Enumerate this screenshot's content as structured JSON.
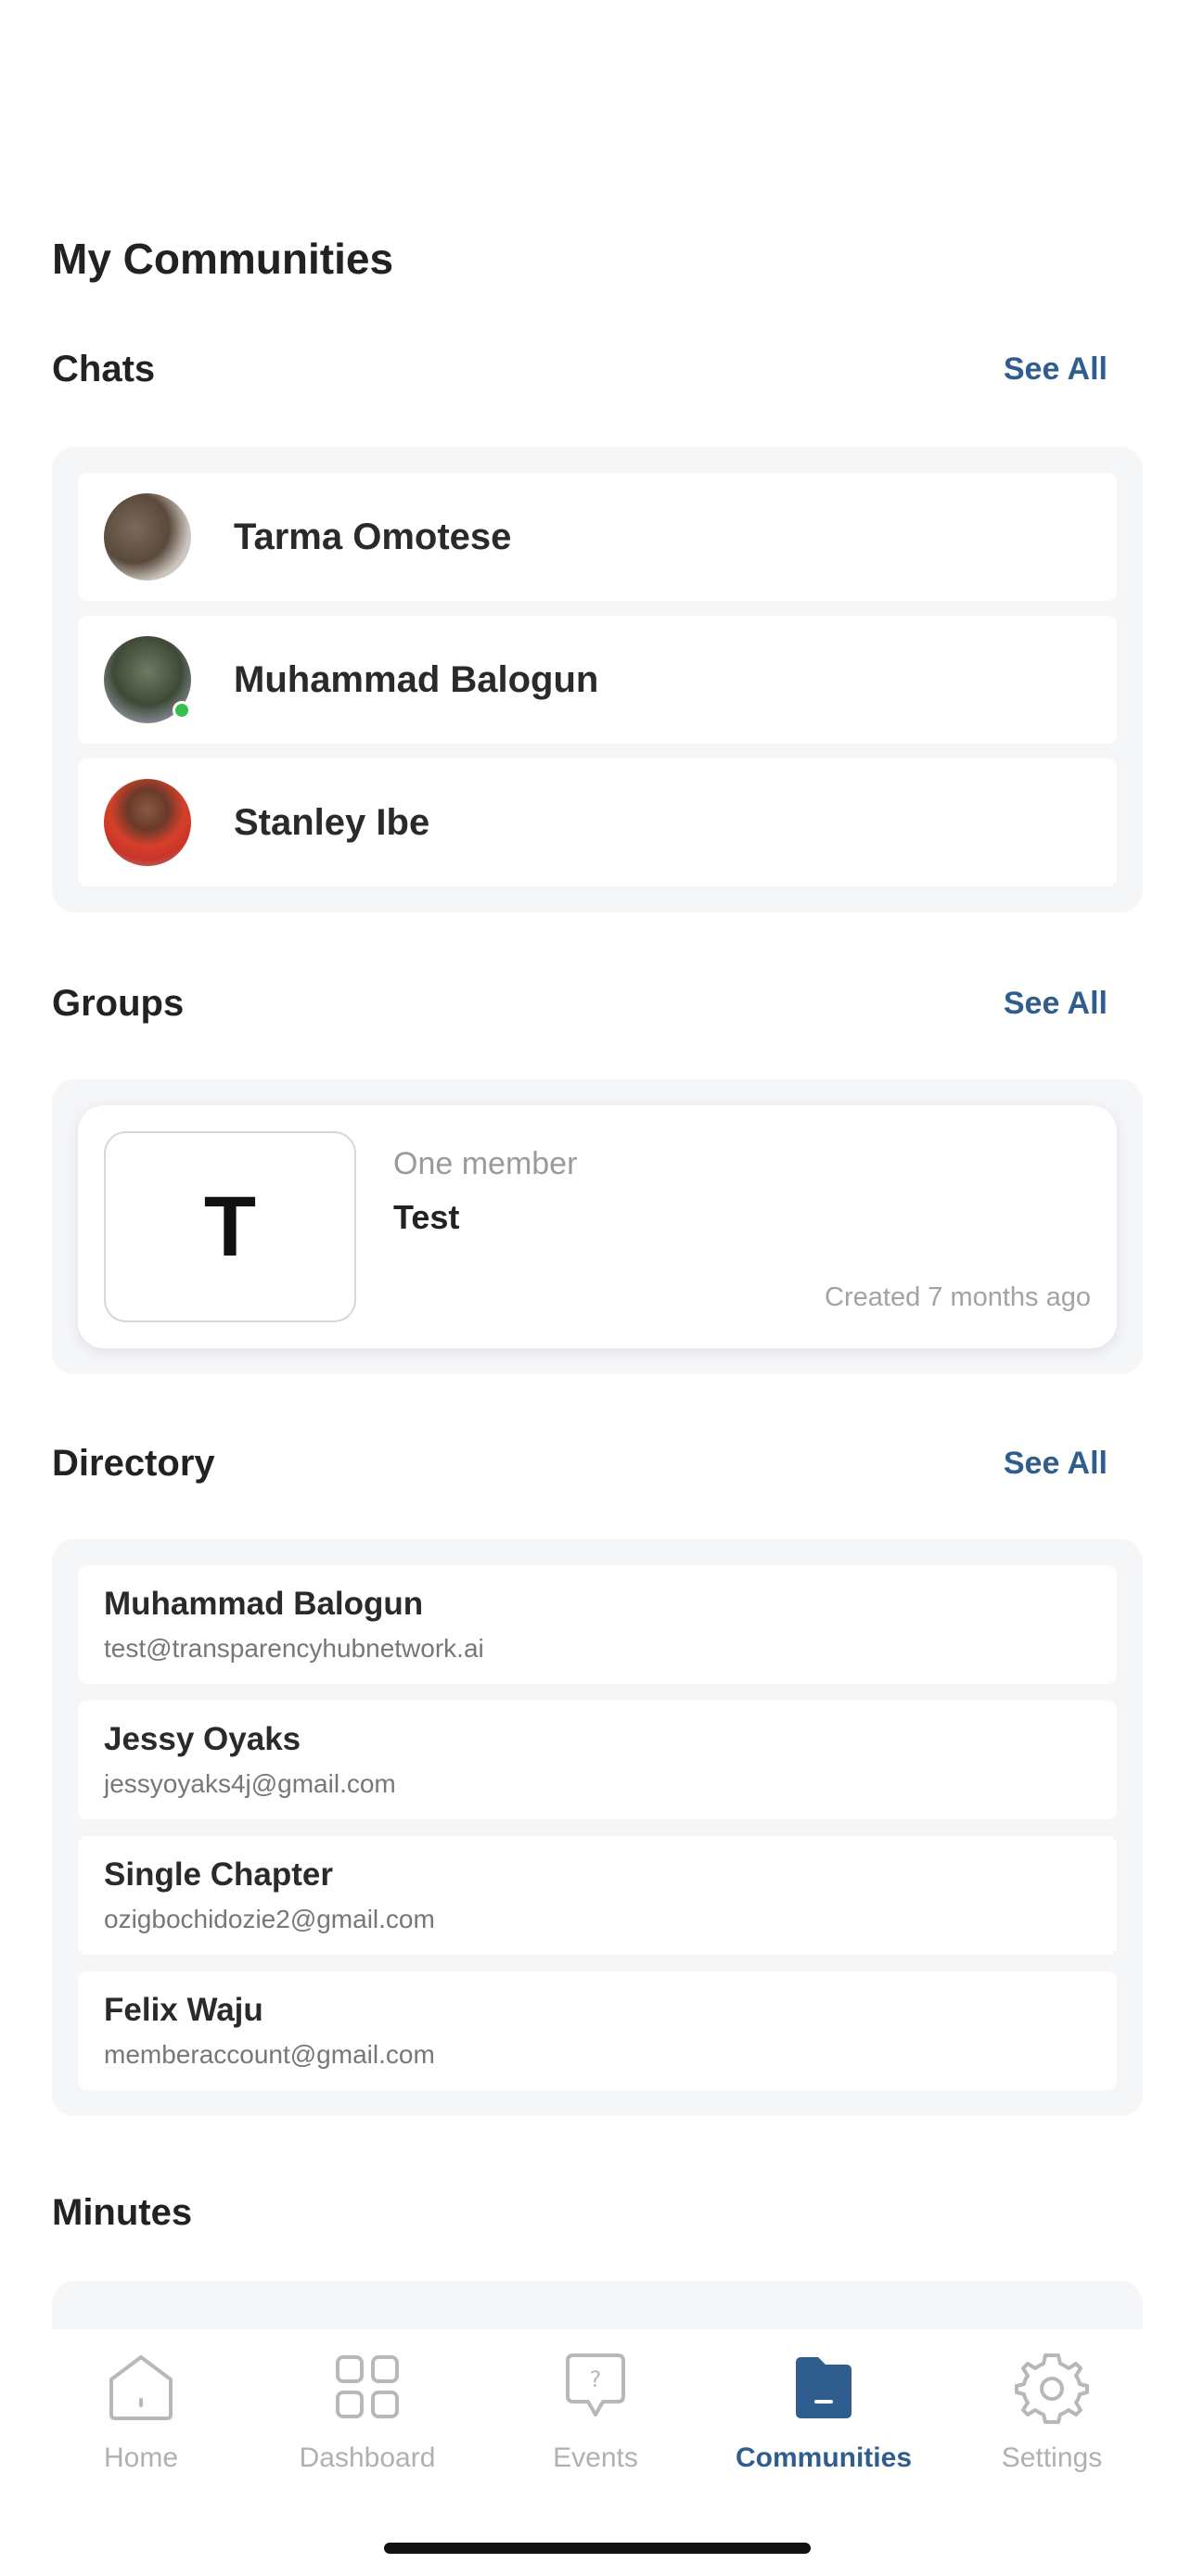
{
  "page_title": "My Communities",
  "chats": {
    "title": "Chats",
    "see_all": "See All",
    "items": [
      {
        "name": "Tarma Omotese",
        "online": false
      },
      {
        "name": "Muhammad Balogun",
        "online": true
      },
      {
        "name": "Stanley Ibe",
        "online": false
      }
    ]
  },
  "groups": {
    "title": "Groups",
    "see_all": "See All",
    "items": [
      {
        "initial": "T",
        "members": "One member",
        "name": "Test",
        "created": "Created 7 months ago"
      }
    ]
  },
  "directory": {
    "title": "Directory",
    "see_all": "See All",
    "items": [
      {
        "name": "Muhammad Balogun",
        "email": "test@transparencyhubnetwork.ai"
      },
      {
        "name": "Jessy Oyaks",
        "email": "jessyoyaks4j@gmail.com"
      },
      {
        "name": "Single Chapter",
        "email": "ozigbochidozie2@gmail.com"
      },
      {
        "name": "Felix Waju",
        "email": "memberaccount@gmail.com"
      }
    ]
  },
  "minutes": {
    "title": "Minutes"
  },
  "tabbar": {
    "tabs": [
      {
        "label": "Home",
        "icon": "home-icon",
        "active": false
      },
      {
        "label": "Dashboard",
        "icon": "dashboard-grid-icon",
        "active": false
      },
      {
        "label": "Events",
        "icon": "question-bubble-icon",
        "active": false
      },
      {
        "label": "Communities",
        "icon": "folder-icon",
        "active": true
      },
      {
        "label": "Settings",
        "icon": "gear-icon",
        "active": false
      }
    ]
  },
  "colors": {
    "accent": "#2f5e8e",
    "online": "#34c04a",
    "panel_bg": "#f5f6f8",
    "inactive_tab": "#b0b0b0"
  }
}
